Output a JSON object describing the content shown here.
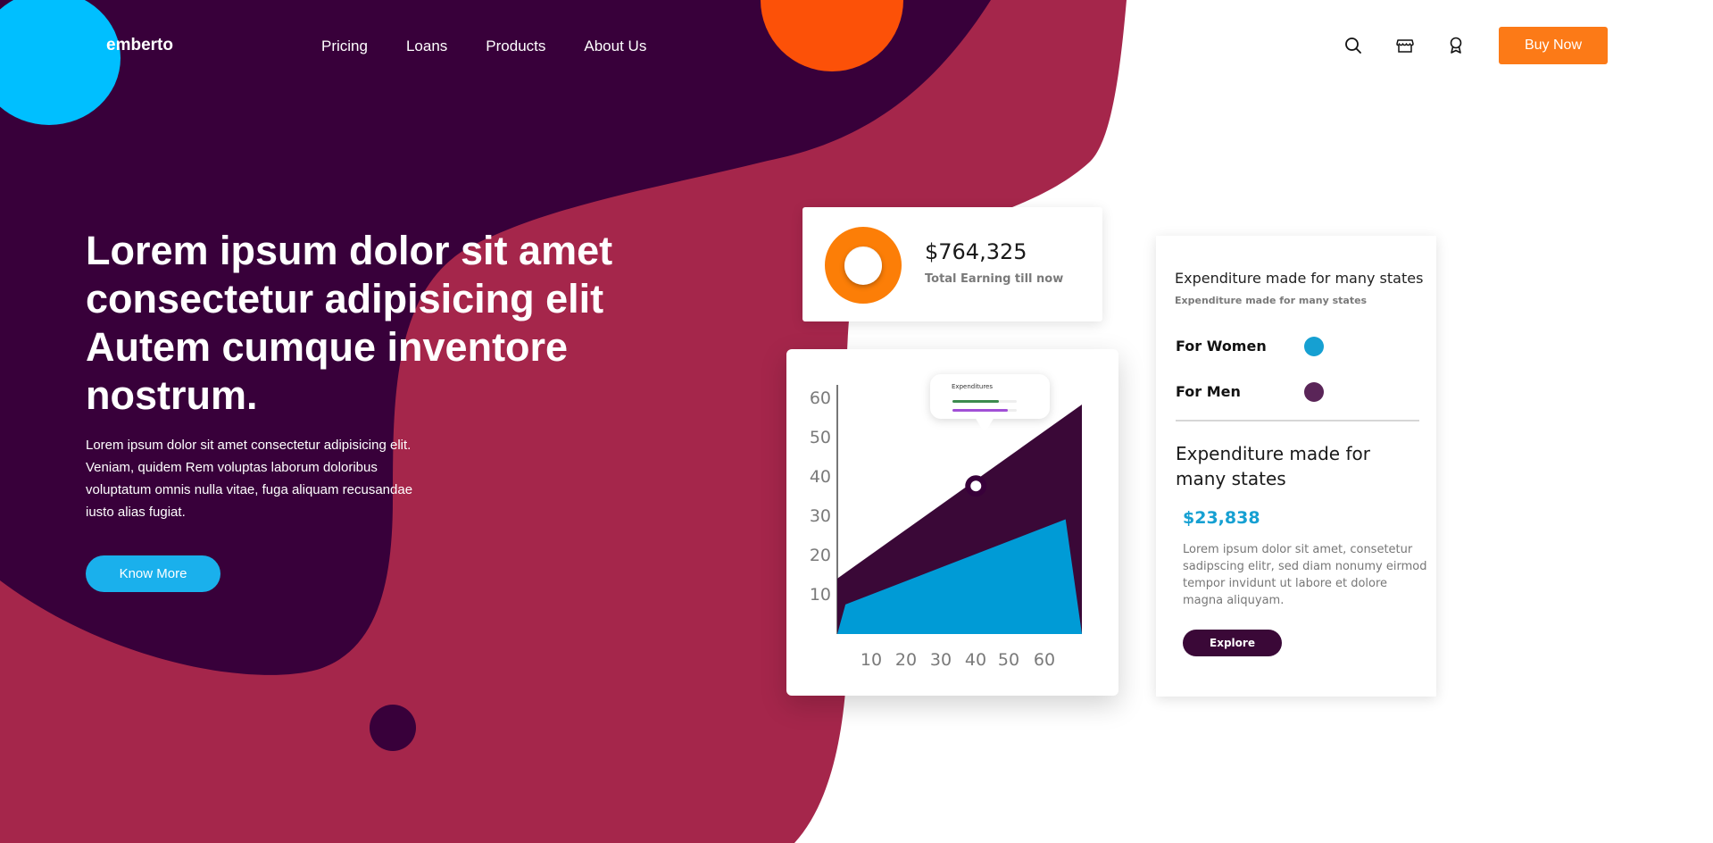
{
  "brand": {
    "logo": "emberto"
  },
  "nav": {
    "links": [
      "Pricing",
      "Loans",
      "Products",
      "About Us"
    ],
    "icons": [
      "search-icon",
      "store-icon",
      "award-icon"
    ],
    "cta_label": "Buy Now"
  },
  "hero": {
    "title": "Lorem ipsum dolor sit amet consectetur adipisicing elit Autem cumque inventore nostrum.",
    "text": "Lorem ipsum dolor sit amet consectetur adipisicing elit. Veniam, quidem Rem voluptas laborum doloribus voluptatum omnis nulla vitae, fuga aliquam recusandae iusto alias fugiat.",
    "button_label": "Know More"
  },
  "earnings": {
    "value": "$764,325",
    "label": "Total Earning till now"
  },
  "chart_data": {
    "type": "area",
    "title": "",
    "xlabel": "",
    "ylabel": "",
    "x_ticks": [
      10,
      20,
      30,
      40,
      50,
      60
    ],
    "y_ticks": [
      10,
      20,
      30,
      40,
      50,
      60
    ],
    "tooltip_title": "Expenditures",
    "series": [
      {
        "color": "#3a0837",
        "x": [
          10,
          70
        ],
        "y": [
          15,
          62
        ]
      },
      {
        "color": "#009bd6",
        "x": [
          10,
          12,
          66,
          70
        ],
        "y": [
          0,
          8,
          31,
          0
        ]
      }
    ],
    "marker": {
      "x": 44,
      "y": 40
    },
    "grid": false
  },
  "expenditure": {
    "title": "Expenditure made for many states",
    "subtitle": "Expenditure made for many states",
    "legend": [
      {
        "label": "For Women",
        "color": "#16a0d2"
      },
      {
        "label": "For Men",
        "color": "#5a2558"
      }
    ],
    "heading": "Expenditure made for many states",
    "amount": "$23,838",
    "text": "Lorem ipsum dolor sit amet, consetetur sadipscing elitr, sed diam nonumy eirmod tempor invidunt ut labore et dolore magna aliquyam.",
    "button_label": "Explore"
  },
  "colors": {
    "dark_purple": "#38003a",
    "crimson": "#a5264b",
    "cyan": "#00bfff",
    "orange": "#fc5108",
    "cta_orange": "#fc7a17",
    "know_blue": "#1ab0ec"
  }
}
